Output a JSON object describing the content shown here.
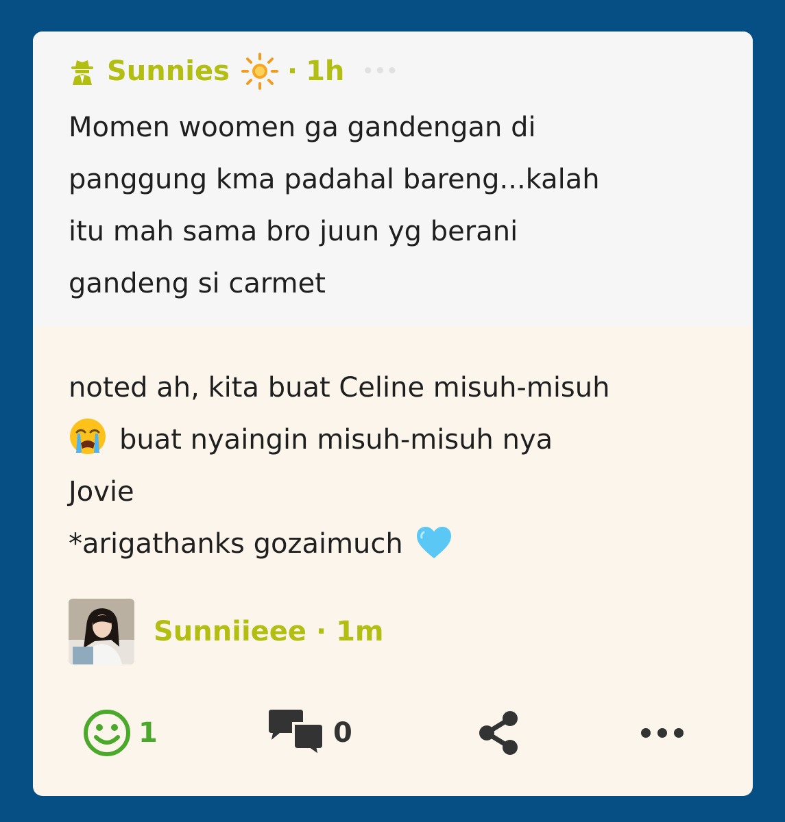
{
  "quote": {
    "author": "Sunnies",
    "separator": "·",
    "time": "1h",
    "more": "•••",
    "text": "Momen woomen ga gandengan di\npanggung kma padahal bareng...kalah\nitu mah sama bro juun yg berani\ngandeng si carmet"
  },
  "reply": {
    "line1": "noted ah, kita buat Celine misuh-misuh",
    "line2": "buat nyaingin misuh-misuh nya",
    "line3": "Jovie",
    "line4": "*arigathanks gozaimuch",
    "author": "Sunniieee · 1m"
  },
  "actions": {
    "reactions": "1",
    "comments": "0"
  },
  "colors": {
    "background": "#054f85",
    "accent": "#b3be12",
    "quote_bg": "#f6f6f6",
    "card_bg": "#fcf5ec",
    "reaction": "#4aa82a"
  },
  "icons": [
    "spy-icon",
    "sun-icon",
    "sob-emoji",
    "blue-heart-emoji",
    "smile-icon",
    "comments-icon",
    "share-icon",
    "more-icon"
  ]
}
